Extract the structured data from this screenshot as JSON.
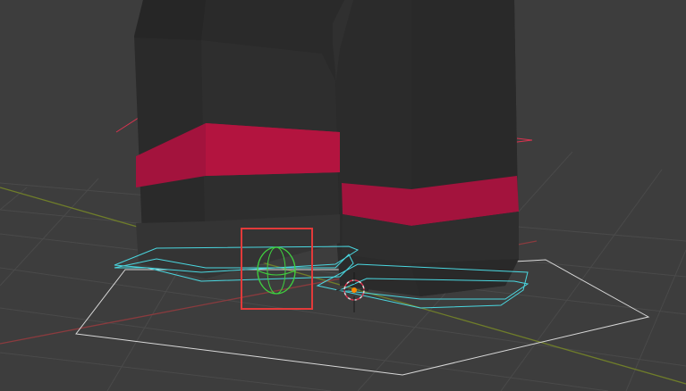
{
  "viewport": {
    "mode": "3d-viewport",
    "background_color": "#3d3d3d",
    "grid_color": "#4a4a4a"
  },
  "colors": {
    "x_axis": "#8a3b3e",
    "y_axis": "#6f7d2a",
    "mesh_dark": "#2b2b2b",
    "mesh_stripe": "#a3133d",
    "selected_bone": "#4ad7e0",
    "ik_control": "#3fd03f",
    "highlight_box": "#e23a3a",
    "ground_outline": "#d8d8d8",
    "pole_outline": "#d9334f",
    "origin_point": "#ff8a00"
  },
  "objects": {
    "left_leg": {
      "name": "left-leg-mesh"
    },
    "right_leg": {
      "name": "right-leg-mesh"
    },
    "ik_control": {
      "name": "foot-ik-control"
    },
    "origin": {
      "name": "object-origin"
    }
  }
}
